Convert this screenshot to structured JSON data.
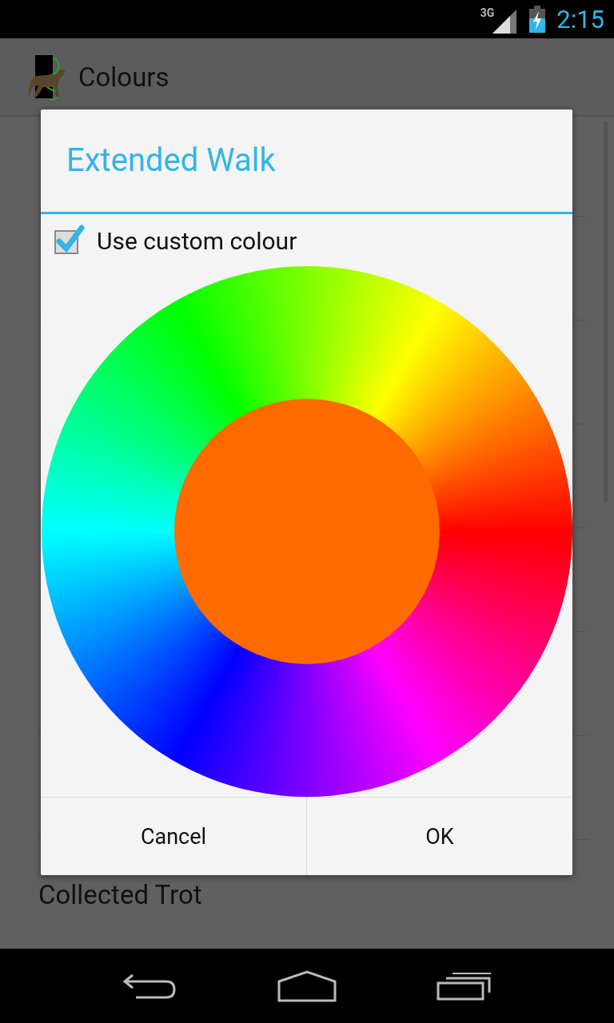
{
  "status_bar": {
    "network": "3G",
    "time": "2:15"
  },
  "action_bar": {
    "title": "Colours"
  },
  "list": {
    "items": [
      {
        "label": "Collected Trot"
      }
    ]
  },
  "dialog": {
    "title": "Extended Walk",
    "checkbox": {
      "label": "Use custom colour",
      "checked": true
    },
    "colour_wheel": {
      "color": "#ff6a00"
    },
    "buttons": [
      "Cancel",
      "OK"
    ]
  }
}
